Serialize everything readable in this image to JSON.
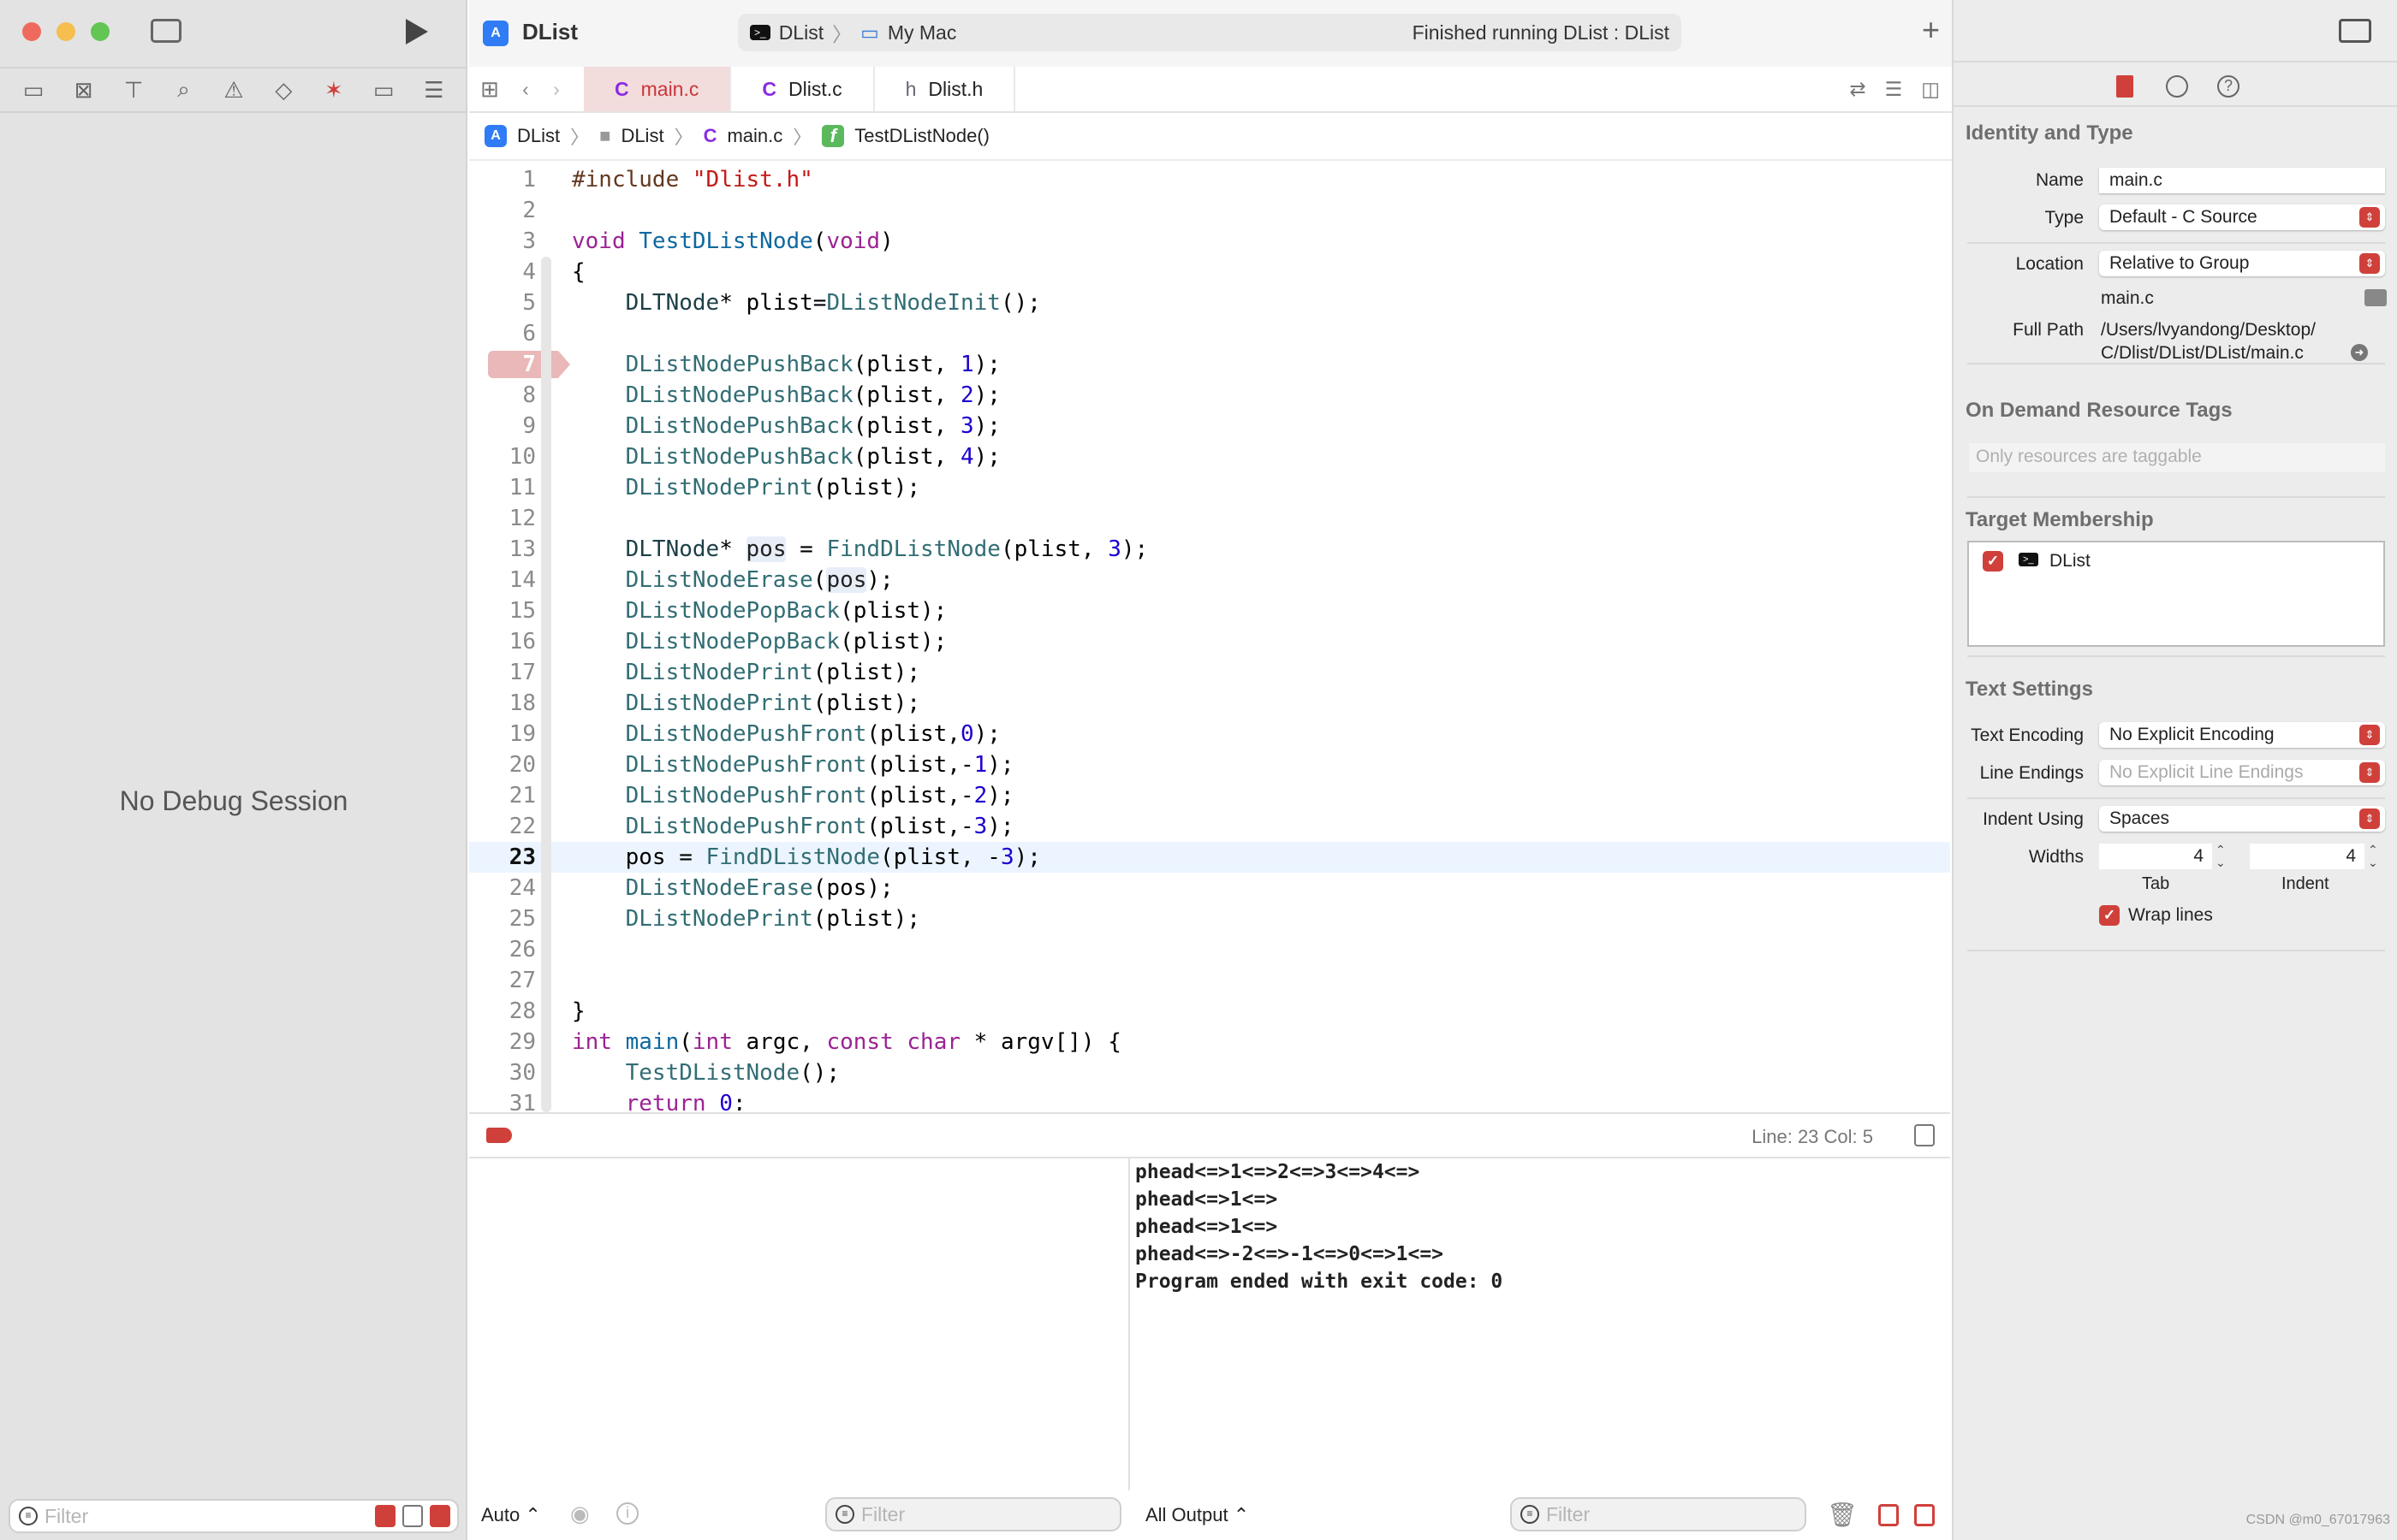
{
  "window": {
    "project_title": "DList",
    "run_status": "Finished running DList : DList",
    "scheme": "DList",
    "destination": "My Mac"
  },
  "navigator": {
    "icons": [
      "folder-icon",
      "source-control-icon",
      "hierarchy-icon",
      "search-icon",
      "warning-icon",
      "test-diamond-icon",
      "debug-spray-icon",
      "breakpoint-icon",
      "report-icon"
    ],
    "empty_message": "No Debug Session",
    "filter_placeholder": "Filter"
  },
  "tabs": [
    {
      "icon": "C",
      "label": "main.c",
      "active": true
    },
    {
      "icon": "C",
      "label": "Dlist.c",
      "active": false
    },
    {
      "icon": "h",
      "label": "Dlist.h",
      "active": false
    }
  ],
  "jumpbar": [
    "DList",
    "DList",
    "main.c",
    "TestDListNode()"
  ],
  "editor": {
    "breakpoint_line": 7,
    "current_line": 23,
    "lines": [
      [
        [
          "#include ",
          "pp"
        ],
        [
          "\"Dlist.h\"",
          "st"
        ]
      ],
      [],
      [
        [
          "void",
          "kw"
        ],
        [
          " ",
          "pl"
        ],
        [
          "TestDListNode",
          "fd"
        ],
        [
          "(",
          "pl"
        ],
        [
          "void",
          "kw"
        ],
        [
          ")",
          "pl"
        ]
      ],
      [
        [
          "{",
          "pl"
        ]
      ],
      [
        [
          "    ",
          "pl"
        ],
        [
          "DLTNode",
          "ty"
        ],
        [
          "* plist=",
          "pl"
        ],
        [
          "DListNodeInit",
          "fc"
        ],
        [
          "();",
          "pl"
        ]
      ],
      [],
      [
        [
          "    ",
          "pl"
        ],
        [
          "DListNodePushBack",
          "fc"
        ],
        [
          "(plist, ",
          "pl"
        ],
        [
          "1",
          "nu"
        ],
        [
          ");",
          "pl"
        ]
      ],
      [
        [
          "    ",
          "pl"
        ],
        [
          "DListNodePushBack",
          "fc"
        ],
        [
          "(plist, ",
          "pl"
        ],
        [
          "2",
          "nu"
        ],
        [
          ");",
          "pl"
        ]
      ],
      [
        [
          "    ",
          "pl"
        ],
        [
          "DListNodePushBack",
          "fc"
        ],
        [
          "(plist, ",
          "pl"
        ],
        [
          "3",
          "nu"
        ],
        [
          ");",
          "pl"
        ]
      ],
      [
        [
          "    ",
          "pl"
        ],
        [
          "DListNodePushBack",
          "fc"
        ],
        [
          "(plist, ",
          "pl"
        ],
        [
          "4",
          "nu"
        ],
        [
          ");",
          "pl"
        ]
      ],
      [
        [
          "    ",
          "pl"
        ],
        [
          "DListNodePrint",
          "fc"
        ],
        [
          "(plist);",
          "pl"
        ]
      ],
      [],
      [
        [
          "    ",
          "pl"
        ],
        [
          "DLTNode",
          "ty"
        ],
        [
          "* ",
          "pl"
        ],
        [
          "pos",
          "hl"
        ],
        [
          " = ",
          "pl"
        ],
        [
          "FindDListNode",
          "fc"
        ],
        [
          "(plist, ",
          "pl"
        ],
        [
          "3",
          "nu"
        ],
        [
          ");",
          "pl"
        ]
      ],
      [
        [
          "    ",
          "pl"
        ],
        [
          "DListNodeErase",
          "fc"
        ],
        [
          "(",
          "pl"
        ],
        [
          "pos",
          "hl"
        ],
        [
          ");",
          "pl"
        ]
      ],
      [
        [
          "    ",
          "pl"
        ],
        [
          "DListNodePopBack",
          "fc"
        ],
        [
          "(plist);",
          "pl"
        ]
      ],
      [
        [
          "    ",
          "pl"
        ],
        [
          "DListNodePopBack",
          "fc"
        ],
        [
          "(plist);",
          "pl"
        ]
      ],
      [
        [
          "    ",
          "pl"
        ],
        [
          "DListNodePrint",
          "fc"
        ],
        [
          "(plist);",
          "pl"
        ]
      ],
      [
        [
          "    ",
          "pl"
        ],
        [
          "DListNodePrint",
          "fc"
        ],
        [
          "(plist);",
          "pl"
        ]
      ],
      [
        [
          "    ",
          "pl"
        ],
        [
          "DListNodePushFront",
          "fc"
        ],
        [
          "(plist,",
          "pl"
        ],
        [
          "0",
          "nu"
        ],
        [
          ");",
          "pl"
        ]
      ],
      [
        [
          "    ",
          "pl"
        ],
        [
          "DListNodePushFront",
          "fc"
        ],
        [
          "(plist,-",
          "pl"
        ],
        [
          "1",
          "nu"
        ],
        [
          ");",
          "pl"
        ]
      ],
      [
        [
          "    ",
          "pl"
        ],
        [
          "DListNodePushFront",
          "fc"
        ],
        [
          "(plist,-",
          "pl"
        ],
        [
          "2",
          "nu"
        ],
        [
          ");",
          "pl"
        ]
      ],
      [
        [
          "    ",
          "pl"
        ],
        [
          "DListNodePushFront",
          "fc"
        ],
        [
          "(plist,-",
          "pl"
        ],
        [
          "3",
          "nu"
        ],
        [
          ");",
          "pl"
        ]
      ],
      [
        [
          "    pos = ",
          "pl"
        ],
        [
          "FindDListNode",
          "fc"
        ],
        [
          "(plist, -",
          "pl"
        ],
        [
          "3",
          "nu"
        ],
        [
          ");",
          "pl"
        ]
      ],
      [
        [
          "    ",
          "pl"
        ],
        [
          "DListNodeErase",
          "fc"
        ],
        [
          "(pos);",
          "pl"
        ]
      ],
      [
        [
          "    ",
          "pl"
        ],
        [
          "DListNodePrint",
          "fc"
        ],
        [
          "(plist);",
          "pl"
        ]
      ],
      [],
      [],
      [
        [
          "}",
          "pl"
        ]
      ],
      [
        [
          "int",
          "kw"
        ],
        [
          " ",
          "pl"
        ],
        [
          "main",
          "fd"
        ],
        [
          "(",
          "pl"
        ],
        [
          "int",
          "kw"
        ],
        [
          " argc, ",
          "pl"
        ],
        [
          "const",
          "kw"
        ],
        [
          " ",
          "pl"
        ],
        [
          "char",
          "kw"
        ],
        [
          " * argv[]) {",
          "pl"
        ]
      ],
      [
        [
          "    ",
          "pl"
        ],
        [
          "TestDListNode",
          "fc"
        ],
        [
          "();",
          "pl"
        ]
      ],
      [
        [
          "    ",
          "pl"
        ],
        [
          "return",
          "kw"
        ],
        [
          " ",
          "pl"
        ],
        [
          "0",
          "nu"
        ],
        [
          ";",
          "pl"
        ]
      ]
    ]
  },
  "debug_bar": {
    "position": "Line: 23  Col: 5"
  },
  "console": {
    "output": [
      "phead<=>1<=>2<=>3<=>4<=>",
      "phead<=>1<=>",
      "phead<=>1<=>",
      "phead<=>-2<=>-1<=>0<=>1<=>",
      "Program ended with exit code: 0"
    ],
    "auto_label": "Auto ⌃",
    "output_select": "All Output ⌃",
    "filter_placeholder": "Filter"
  },
  "inspector": {
    "identity_header": "Identity and Type",
    "name_label": "Name",
    "name_value": "main.c",
    "type_label": "Type",
    "type_value": "Default - C Source",
    "location_label": "Location",
    "location_value": "Relative to Group",
    "location_file": "main.c",
    "full_path_label": "Full Path",
    "full_path_value": "/Users/lvyandong/Desktop/ C/Dlist/DList/DList/main.c",
    "odr_header": "On Demand Resource Tags",
    "odr_placeholder": "Only resources are taggable",
    "target_header": "Target Membership",
    "target_name": "DList",
    "target_checked": true,
    "text_header": "Text Settings",
    "encoding_label": "Text Encoding",
    "encoding_value": "No Explicit Encoding",
    "line_endings_label": "Line Endings",
    "line_endings_value": "No Explicit Line Endings",
    "indent_label": "Indent Using",
    "indent_value": "Spaces",
    "widths_label": "Widths",
    "tab_width": "4",
    "indent_width": "4",
    "tab_caption": "Tab",
    "indent_caption": "Indent",
    "wrap_label": "Wrap lines",
    "wrap_checked": true
  },
  "watermark": "CSDN @m0_67017963",
  "colors": {
    "accent": "#d0403b",
    "current_line": "#ecf5ff",
    "breakpoint": "#eab8b8"
  }
}
